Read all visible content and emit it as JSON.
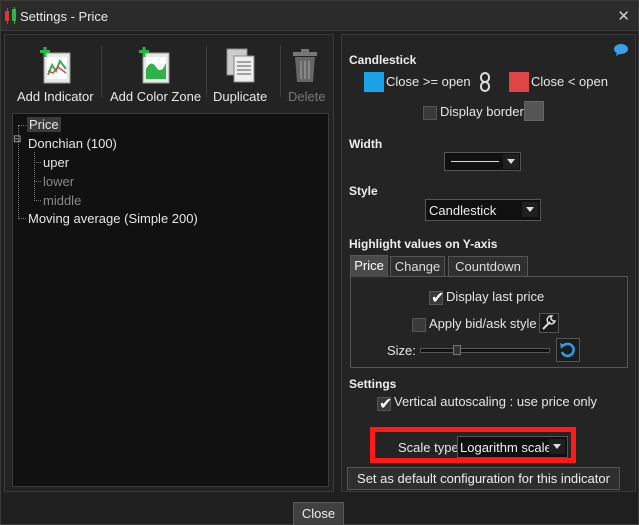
{
  "window": {
    "title": "Settings - Price",
    "close_label": "✕"
  },
  "toolbar": {
    "add_indicator": "Add Indicator",
    "add_color_zone": "Add Color Zone",
    "duplicate": "Duplicate",
    "delete": "Delete"
  },
  "tree": {
    "items": [
      "Price",
      "Donchian (100)",
      "uper",
      "lower",
      "middle",
      "Moving average (Simple 200)"
    ],
    "expander": "⊟"
  },
  "right": {
    "candlestick_title": "Candlestick",
    "close_up_label": "Close >= open",
    "close_down_label": "Close < open",
    "close_up_color": "#1aa3e8",
    "close_down_color": "#e04545",
    "display_border_label": "Display border",
    "width_title": "Width",
    "style_title": "Style",
    "style_value": "Candlestick",
    "highlight_title": "Highlight values on Y-axis",
    "tabs": [
      "Price",
      "Change",
      "Countdown"
    ],
    "display_last_price": "Display last price",
    "apply_bid_ask": "Apply bid/ask style",
    "size_label": "Size:",
    "slider_level": 0.27,
    "settings_title": "Settings",
    "vertical_autoscaling": "Vertical autoscaling : use price only",
    "scale_type_label": "Scale type",
    "scale_type_value": "Logarithm scale",
    "set_default_button": "Set as default configuration for this indicator"
  },
  "footer": {
    "close_button": "Close"
  },
  "colors": {
    "accent_blue": "#1aa3e8",
    "highlight_red": "#ff1a1a"
  }
}
